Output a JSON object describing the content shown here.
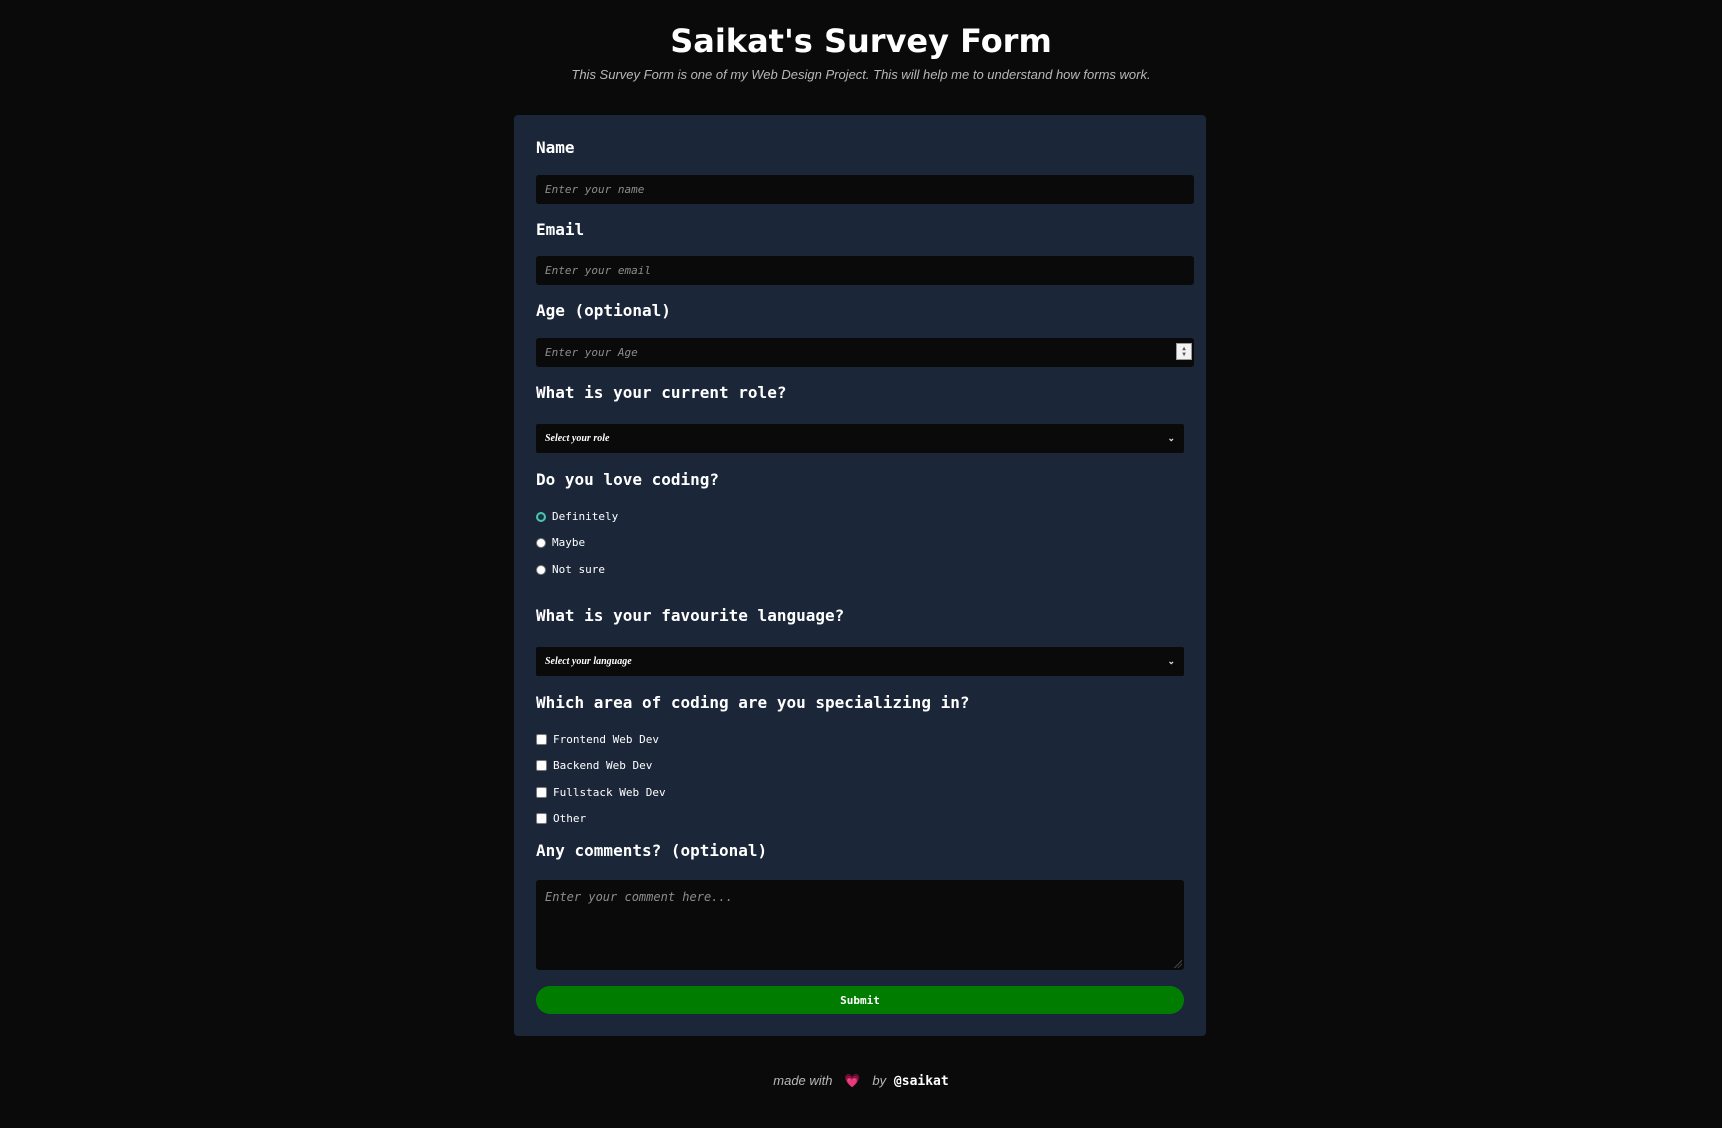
{
  "header": {
    "title": "Saikat's Survey Form",
    "description": "This Survey Form is one of my Web Design Project. This will help me to understand how forms work."
  },
  "form": {
    "name": {
      "label": "Name",
      "placeholder": "Enter your name"
    },
    "email": {
      "label": "Email",
      "placeholder": "Enter your email"
    },
    "age": {
      "label": "Age (optional)",
      "placeholder": "Enter your Age"
    },
    "role": {
      "label": "What is your current role?",
      "selected": "Select your role"
    },
    "love_coding": {
      "label": "Do you love coding?",
      "options": [
        "Definitely",
        "Maybe",
        "Not sure"
      ],
      "checked_index": 0
    },
    "language": {
      "label": "What is your favourite language?",
      "selected": "Select your language"
    },
    "specialization": {
      "label": "Which area of coding are you specializing in?",
      "options": [
        "Frontend Web Dev",
        "Backend Web Dev",
        "Fullstack Web Dev",
        "Other"
      ]
    },
    "comments": {
      "label": "Any comments? (optional)",
      "placeholder": "Enter your comment here..."
    },
    "submit_label": "Submit"
  },
  "footer": {
    "made_with": "made with",
    "heart": "💗",
    "by": "by",
    "handle": "@saikat"
  },
  "colors": {
    "background": "#0a0a0a",
    "card": "#1b2639",
    "submit": "#007d00",
    "radio_accent": "#4cc1b6"
  }
}
